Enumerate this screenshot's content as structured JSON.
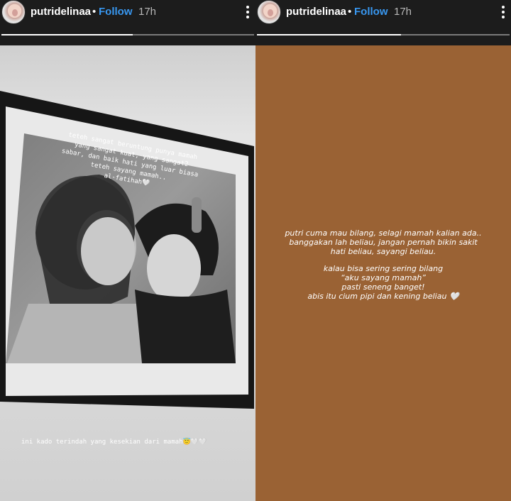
{
  "colors": {
    "follow": "#3897f0",
    "right_story_bg": "#9a6234",
    "header_bg": "#1c1c1c"
  },
  "left_story": {
    "username": "putridelinaa",
    "separator": "•",
    "follow_label": "Follow",
    "time": "17h",
    "progress_fraction": 0.52,
    "caption_top": "teteh sangat beruntung punya mamah\nyang sangat kuat, yang sangat2\nsabar, dan baik hati yang luar biasa\nteteh sayang mamah..\nal-fatihah🤍",
    "caption_bottom": "ini kado terindah yang kesekian dari mamah😇🤍🤍"
  },
  "right_story": {
    "username": "putridelinaa",
    "separator": "•",
    "follow_label": "Follow",
    "time": "17h",
    "progress_fraction": 0.57,
    "paragraph_1": [
      "putri cuma mau bilang, selagi mamah kalian ada..",
      "banggakan lah beliau, jangan pernah bikin sakit",
      "hati beliau, sayangi beliau."
    ],
    "paragraph_2": [
      "kalau bisa sering sering bilang",
      "“aku sayang mamah”",
      "pasti seneng banget!",
      "abis itu cium pipi dan kening beliau 🤍"
    ]
  }
}
